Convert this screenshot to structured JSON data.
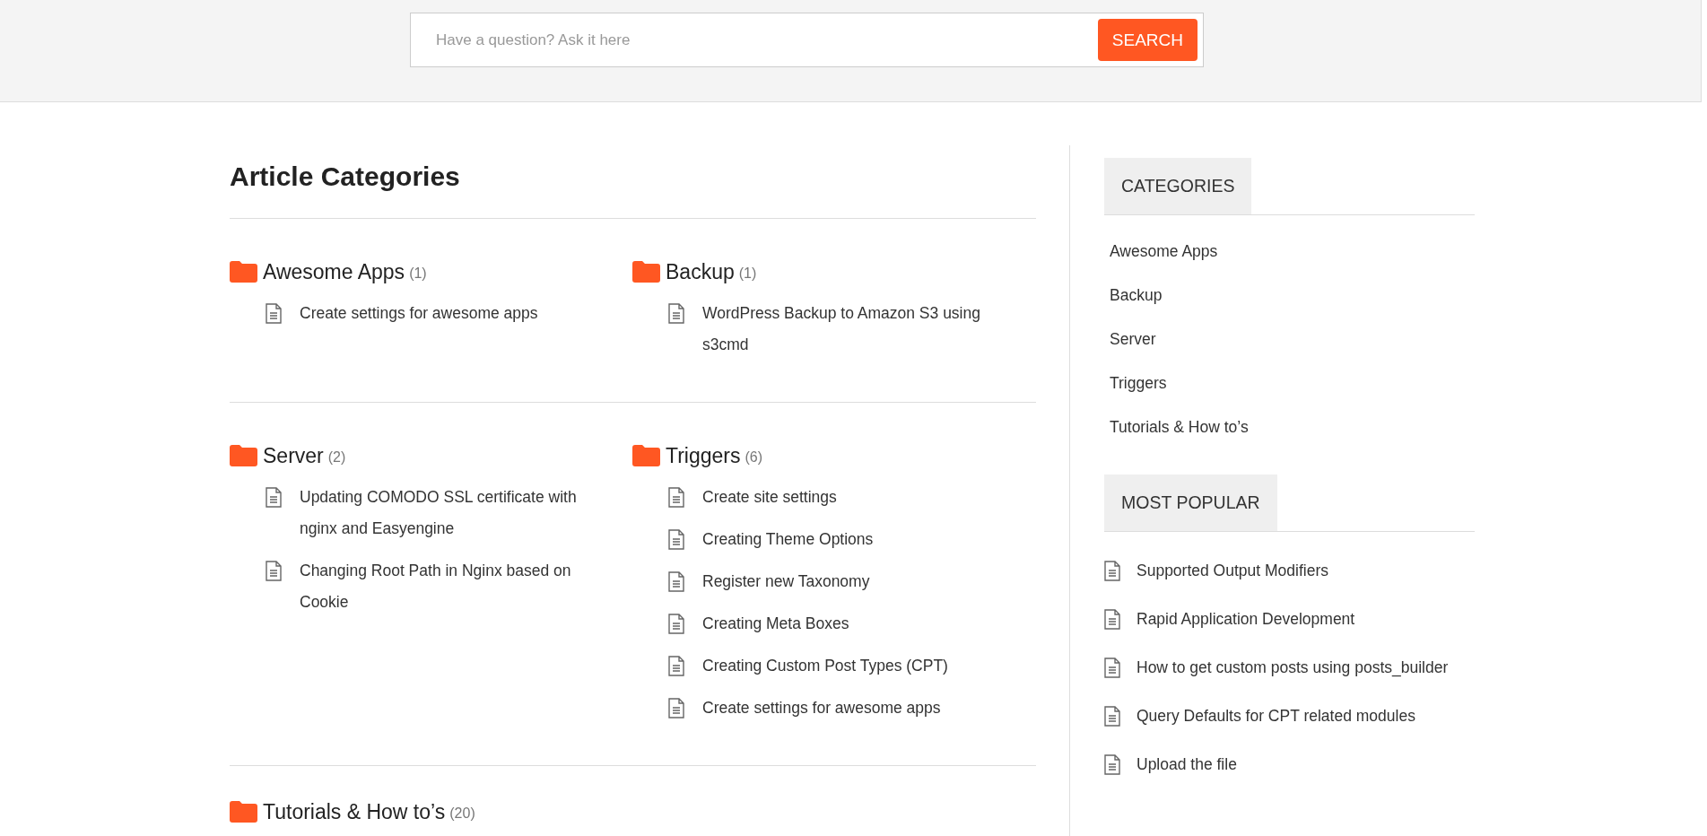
{
  "search": {
    "placeholder": "Have a question? Ask it here",
    "button": "SEARCH"
  },
  "main": {
    "title": "Article Categories",
    "categories": [
      {
        "name": "Awesome Apps",
        "count": "(1)",
        "articles": [
          "Create settings for awesome apps"
        ]
      },
      {
        "name": "Backup",
        "count": "(1)",
        "articles": [
          "WordPress Backup to Amazon S3 using s3cmd"
        ]
      },
      {
        "name": "Server",
        "count": "(2)",
        "articles": [
          "Updating COMODO SSL certificate with nginx and Easyengine",
          "Changing Root Path in Nginx based on Cookie"
        ]
      },
      {
        "name": "Triggers",
        "count": "(6)",
        "articles": [
          "Create site settings",
          "Creating Theme Options",
          "Register new Taxonomy",
          "Creating Meta Boxes",
          "Creating Custom Post Types (CPT)",
          "Create settings for awesome apps"
        ]
      },
      {
        "name": "Tutorials & How to’s",
        "count": "(20)"
      }
    ]
  },
  "sidebar": {
    "widgets": [
      {
        "kind": "links",
        "title": "CATEGORIES",
        "items": [
          "Awesome Apps",
          "Backup",
          "Server",
          "Triggers",
          "Tutorials & How to’s"
        ]
      },
      {
        "kind": "articles",
        "title": "MOST POPULAR",
        "items": [
          "Supported Output Modifiers",
          "Rapid Application Development",
          "How to get custom posts using posts_builder",
          "Query Defaults for CPT related modules",
          "Upload the file"
        ]
      }
    ]
  }
}
